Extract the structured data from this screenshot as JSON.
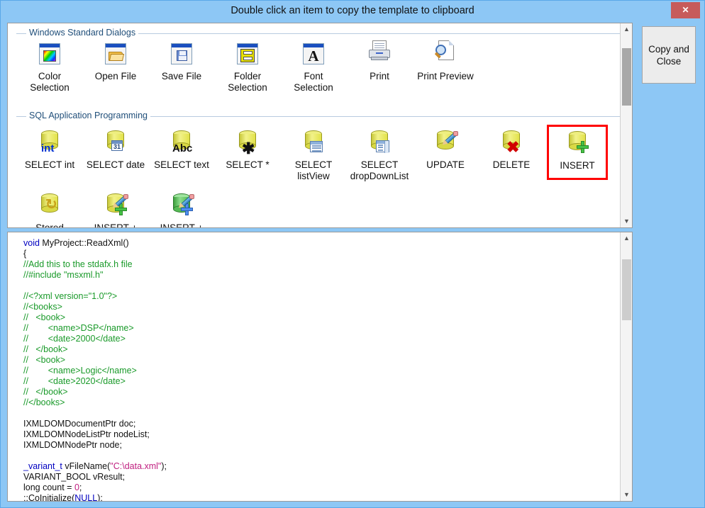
{
  "window": {
    "title": "Double click an item to copy the template to clipboard",
    "close_label": "✕",
    "titlebar_color": "#8dc7f5",
    "close_color": "#c75b5b"
  },
  "sidebar": {
    "copy_close_label": "Copy and\nClose"
  },
  "groups": [
    {
      "label": "Windows Standard Dialogs",
      "items": [
        {
          "label": "Color\nSelection",
          "icon": "color-selection-icon",
          "selected": false
        },
        {
          "label": "Open File",
          "icon": "open-file-icon",
          "selected": false
        },
        {
          "label": "Save File",
          "icon": "save-file-icon",
          "selected": false
        },
        {
          "label": "Folder\nSelection",
          "icon": "folder-selection-icon",
          "selected": false
        },
        {
          "label": "Font\nSelection",
          "icon": "font-selection-icon",
          "selected": false
        },
        {
          "label": "Print",
          "icon": "print-icon",
          "selected": false
        },
        {
          "label": "Print Preview",
          "icon": "print-preview-icon",
          "selected": false
        }
      ]
    },
    {
      "label": "SQL Application Programming",
      "items": [
        {
          "label": "SELECT int",
          "icon": "db-select-int-icon",
          "selected": false
        },
        {
          "label": "SELECT date",
          "icon": "db-select-date-icon",
          "selected": false
        },
        {
          "label": "SELECT text",
          "icon": "db-select-text-icon",
          "selected": false
        },
        {
          "label": "SELECT *",
          "icon": "db-select-all-icon",
          "selected": false
        },
        {
          "label": "SELECT\nlistView",
          "icon": "db-select-listview-icon",
          "selected": false
        },
        {
          "label": "SELECT\ndropDownList",
          "icon": "db-select-dropdownlist-icon",
          "selected": false
        },
        {
          "label": "UPDATE",
          "icon": "db-update-icon",
          "selected": false
        },
        {
          "label": "DELETE",
          "icon": "db-delete-icon",
          "selected": false
        },
        {
          "label": "INSERT",
          "icon": "db-insert-icon",
          "selected": true
        },
        {
          "label": "Stored",
          "icon": "db-stored-icon",
          "selected": false
        },
        {
          "label": "INSERT +",
          "icon": "db-insert-plus-yellow-icon",
          "selected": false
        },
        {
          "label": "INSERT +",
          "icon": "db-insert-plus-green-icon",
          "selected": false
        }
      ]
    }
  ],
  "selection_highlight_color": "#ff0000",
  "code": {
    "lines": [
      [
        {
          "t": "void ",
          "c": "k"
        },
        {
          "t": "MyProject::ReadXml()",
          "c": ""
        }
      ],
      [
        {
          "t": "{",
          "c": ""
        }
      ],
      [
        {
          "t": "//Add this to the stdafx.h file",
          "c": "c"
        }
      ],
      [
        {
          "t": "//#include \"msxml.h\"",
          "c": "c"
        }
      ],
      [
        {
          "t": "",
          "c": ""
        }
      ],
      [
        {
          "t": "//<?xml version=\"1.0\"?>",
          "c": "c"
        }
      ],
      [
        {
          "t": "//<books>",
          "c": "c"
        }
      ],
      [
        {
          "t": "//   <book>",
          "c": "c"
        }
      ],
      [
        {
          "t": "//        <name>DSP</name>",
          "c": "c"
        }
      ],
      [
        {
          "t": "//        <date>2000</date>",
          "c": "c"
        }
      ],
      [
        {
          "t": "//   </book>",
          "c": "c"
        }
      ],
      [
        {
          "t": "//   <book>",
          "c": "c"
        }
      ],
      [
        {
          "t": "//        <name>Logic</name>",
          "c": "c"
        }
      ],
      [
        {
          "t": "//        <date>2020</date>",
          "c": "c"
        }
      ],
      [
        {
          "t": "//   </book>",
          "c": "c"
        }
      ],
      [
        {
          "t": "//</books>",
          "c": "c"
        }
      ],
      [
        {
          "t": "",
          "c": ""
        }
      ],
      [
        {
          "t": "IXMLDOMDocumentPtr doc;",
          "c": ""
        }
      ],
      [
        {
          "t": "IXMLDOMNodeListPtr nodeList;",
          "c": ""
        }
      ],
      [
        {
          "t": "IXMLDOMNodePtr node;",
          "c": ""
        }
      ],
      [
        {
          "t": "",
          "c": ""
        }
      ],
      [
        {
          "t": "_variant_t ",
          "c": "k"
        },
        {
          "t": "vFileName(",
          "c": ""
        },
        {
          "t": "\"C:\\data.xml\"",
          "c": "s"
        },
        {
          "t": ");",
          "c": ""
        }
      ],
      [
        {
          "t": "VARIANT_BOOL vResult;",
          "c": ""
        }
      ],
      [
        {
          "t": "long count = ",
          "c": ""
        },
        {
          "t": "0",
          "c": "n"
        },
        {
          "t": ";",
          "c": ""
        }
      ],
      [
        {
          "t": "::CoInitialize(",
          "c": ""
        },
        {
          "t": "NULL",
          "c": "k"
        },
        {
          "t": ");",
          "c": ""
        }
      ]
    ]
  },
  "scrollbars": {
    "up_arrow": "▲",
    "down_arrow": "▼",
    "tool_thumb_top_pct": 7,
    "tool_thumb_height_pct": 32,
    "code_thumb_top_pct": 6,
    "code_thumb_height_pct": 25
  }
}
